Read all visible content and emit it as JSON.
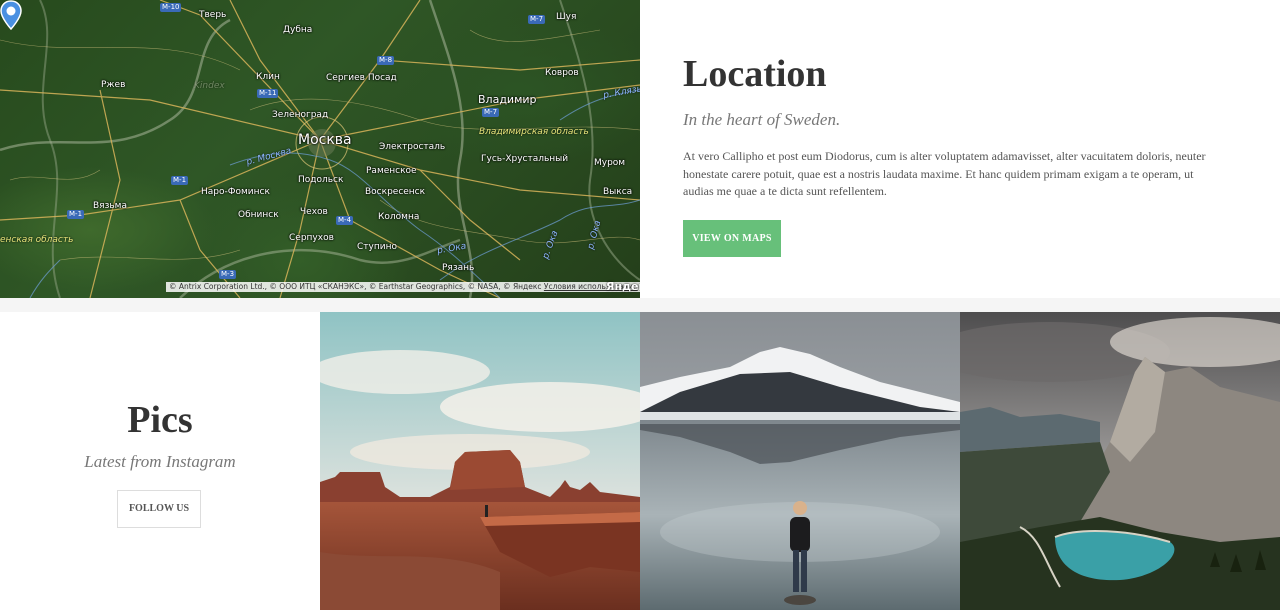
{
  "location": {
    "title": "Location",
    "subtitle": "In the heart of Sweden.",
    "body": "At vero Callipho et post eum Diodorus, cum is alter voluptatem adamavisset, alter vacuitatem doloris, neuter honestate carere potuit, quae est a nostris laudata maxime. Et hanc quidem primam exigam a te operam, ut audias me quae a te dicta sunt refellentem.",
    "button": "VIEW ON MAPS"
  },
  "map": {
    "cities": {
      "tver": "Тверь",
      "dubna": "Дубна",
      "shuya": "Шуя",
      "klin": "Клин",
      "sergiev": "Сергиев Посад",
      "kovrov": "Ковров",
      "rzhev": "Ржев",
      "zelenograd": "Зеленоград",
      "vladimir": "Владимир",
      "moskva": "Москва",
      "elektrostal": "Электросталь",
      "gus": "Гусь-Хрустальный",
      "murom": "Муром",
      "ramenskoe": "Раменское",
      "podolsk": "Подольск",
      "naro": "Наро-Фоминск",
      "voskresensk": "Воскресенск",
      "vyksa": "Выкса",
      "vyazma": "Вязьма",
      "obninsk": "Обнинск",
      "chekhov": "Чехов",
      "kolomna": "Коломна",
      "serpukhov": "Серпухов",
      "stupino": "Ступино",
      "ryazan": "Рязань"
    },
    "regions": {
      "vladimir_obl": "Владимирская область",
      "smolensk_obl": "енская область",
      "ghost": "Kindex"
    },
    "rivers": {
      "moskva": "р. Москва",
      "oka1": "р. Ока",
      "oka2": "р. Ока",
      "oka3": "р. Ока",
      "klyazma": "р. Клязьм"
    },
    "roads": {
      "m10": "M-10",
      "m8": "M-8",
      "m7a": "M-7",
      "m7b": "M-7",
      "m11": "M-11",
      "m1a": "M-1",
      "m1b": "M-1",
      "m4": "M-4",
      "m3": "M-3"
    },
    "attribution_prefix": "© Antrix Corporation Ltd., © ООО ИТЦ «СКАНЭКС», © Earthstar Geographics, © NASA, © Яндекс ",
    "attribution_link": "Условия использования",
    "logo": "Яндекс"
  },
  "pics": {
    "title": "Pics",
    "subtitle": "Latest from Instagram",
    "button": "FOLLOW US"
  }
}
